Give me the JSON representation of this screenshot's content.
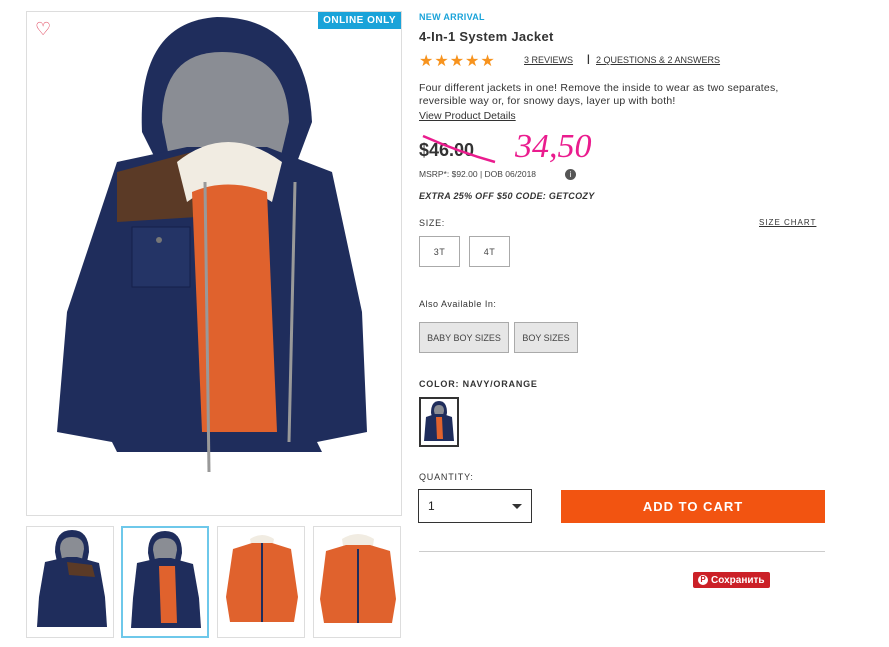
{
  "product": {
    "badge": "ONLINE ONLY",
    "label": "NEW ARRIVAL",
    "title": "4-In-1 System Jacket",
    "stars": "★★★★★",
    "reviews_link": "3 REVIEWS",
    "separator": "|",
    "qa_link": "2 QUESTIONS & 2 ANSWERS",
    "description": "Four different jackets in one! Remove the inside to wear as two separates, reversible way or, for snowy days, layer up with both!",
    "details_link": "View Product Details",
    "old_price": "$46.00",
    "new_price_handwritten": "34,50",
    "msrp_line": "MSRP*: $92.00 | DOB 06/2018",
    "info_icon": "i",
    "promo": "EXTRA 25% OFF $50 CODE: GETCOZY"
  },
  "size": {
    "label": "SIZE:",
    "chart_link": "SIZE CHART",
    "options": [
      "3T",
      "4T"
    ]
  },
  "also_available": {
    "label": "Also Available In:",
    "options": [
      "BABY BOY SIZES",
      "BOY SIZES"
    ]
  },
  "color": {
    "label": "COLOR: NAVY/ORANGE"
  },
  "quantity": {
    "label": "QUANTITY:",
    "value": "1"
  },
  "cart": {
    "button": "ADD TO CART"
  },
  "pinterest": {
    "icon": "P",
    "label": "Сохранить"
  },
  "colors": {
    "accent_blue": "#1aa3d9",
    "star": "#f7931e",
    "cart": "#f25411",
    "handwritten_price": "#ea1c8e",
    "jacket_navy": "#1f2d5c",
    "fleece_orange": "#e0622d"
  }
}
